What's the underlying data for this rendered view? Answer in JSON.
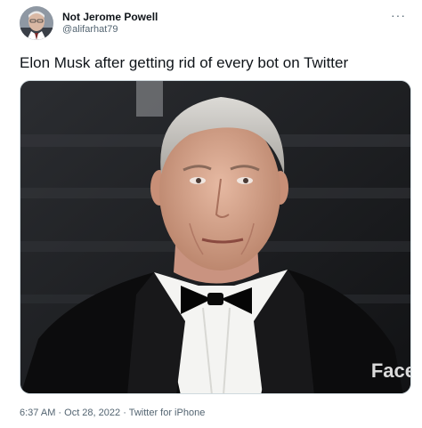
{
  "author": {
    "display_name": "Not Jerome Powell",
    "handle": "@alifarhat79"
  },
  "more_icon": "more-horizontal-icon",
  "more_label": "···",
  "tweet": {
    "text": "Elon Musk after getting rid of every bot on Twitter"
  },
  "media": {
    "watermark": "Face"
  },
  "meta": {
    "time": "6:37 AM",
    "separator": " · ",
    "date": "Oct 28, 2022",
    "source": "Twitter for iPhone"
  }
}
